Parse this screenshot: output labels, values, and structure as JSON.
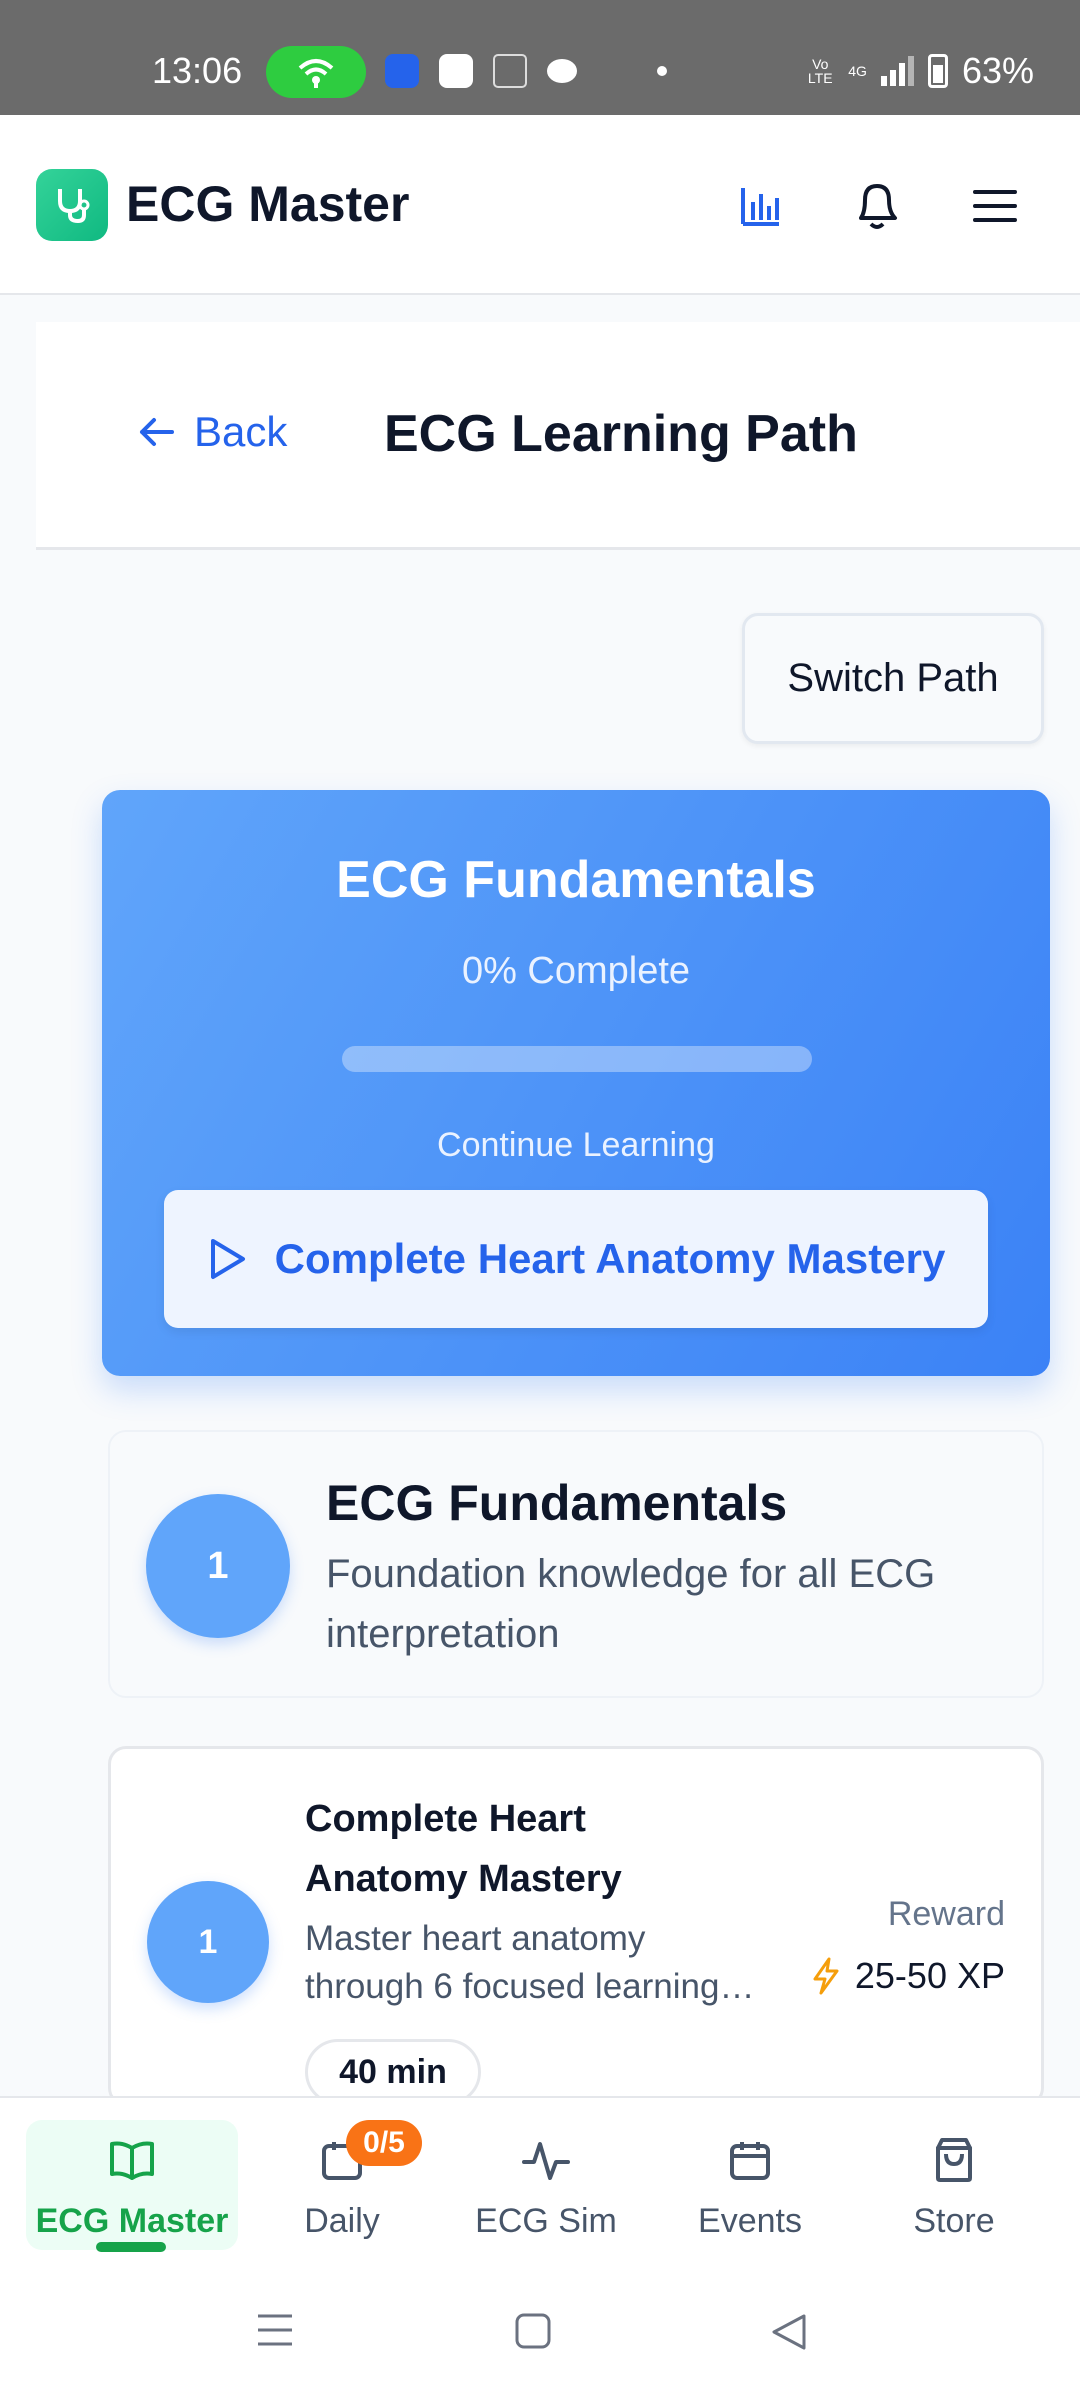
{
  "status_bar": {
    "time": "13:06",
    "network_label": "Vo LTE",
    "signal_label": "4G",
    "battery": "63%"
  },
  "header": {
    "app_title": "ECG Master",
    "icons": [
      "stethoscope-logo-icon",
      "bar-chart-icon",
      "bell-icon",
      "menu-icon"
    ],
    "brand_color": "#10b981"
  },
  "page": {
    "back_label": "Back",
    "title": "ECG Learning Path",
    "switch_label": "Switch Path"
  },
  "hero": {
    "title": "ECG Fundamentals",
    "progress_text": "0% Complete",
    "progress_fraction": 0,
    "continue_label": "Continue Learning",
    "continue_button": "Complete Heart Anatomy Mastery",
    "accent": "#3b82f6"
  },
  "section": {
    "number": "1",
    "title": "ECG Fundamentals",
    "description": "Foundation knowledge for all ECG interpretation"
  },
  "lesson": {
    "number": "1",
    "title": "Complete Heart Anatomy Mastery",
    "description_line1": "Master heart anatomy",
    "description_line2": "through 6 focused learning…",
    "duration": "40 min",
    "reward_label": "Reward",
    "reward_value": "25-50 XP"
  },
  "bottom_nav": {
    "items": [
      {
        "label": "ECG Master",
        "icon": "book-icon",
        "active": true
      },
      {
        "label": "Daily",
        "icon": "calendar-check-icon",
        "badge": "0/5"
      },
      {
        "label": "ECG Sim",
        "icon": "pulse-icon"
      },
      {
        "label": "Events",
        "icon": "calendar-icon"
      },
      {
        "label": "Store",
        "icon": "shopping-bag-icon"
      }
    ],
    "active_color": "#16a34a",
    "badge_color": "#f97316"
  }
}
